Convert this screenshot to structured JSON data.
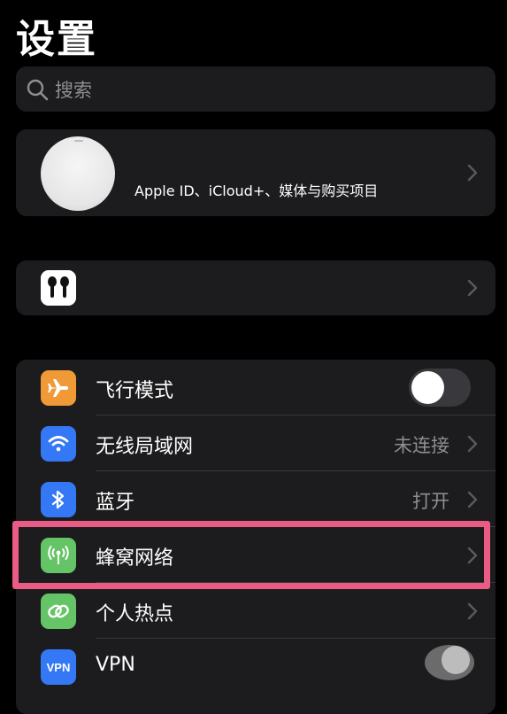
{
  "page": {
    "title": "设置"
  },
  "search": {
    "placeholder": "搜索"
  },
  "profile": {
    "subtitle": "Apple ID、iCloud+、媒体与购买项目"
  },
  "network": {
    "rows": [
      {
        "label": "飞行模式",
        "icon": "airplane-icon",
        "icon_color": "#f09a37",
        "toggle": false
      },
      {
        "label": "无线局域网",
        "value": "未连接",
        "icon": "wifi-icon",
        "icon_color": "#3478f6"
      },
      {
        "label": "蓝牙",
        "value": "打开",
        "icon": "bluetooth-icon",
        "icon_color": "#3478f6"
      },
      {
        "label": "蜂窝网络",
        "icon": "cellular-icon",
        "icon_color": "#65c466"
      },
      {
        "label": "个人热点",
        "icon": "hotspot-icon",
        "icon_color": "#65c466"
      },
      {
        "label": "VPN",
        "icon": "vpn-icon",
        "icon_color": "#3478f6",
        "icon_text": "VPN"
      }
    ]
  },
  "colors": {
    "background": "#000000",
    "card": "#1c1c1e",
    "secondary_text": "#8e8e93",
    "highlight": "#ea5b85"
  }
}
